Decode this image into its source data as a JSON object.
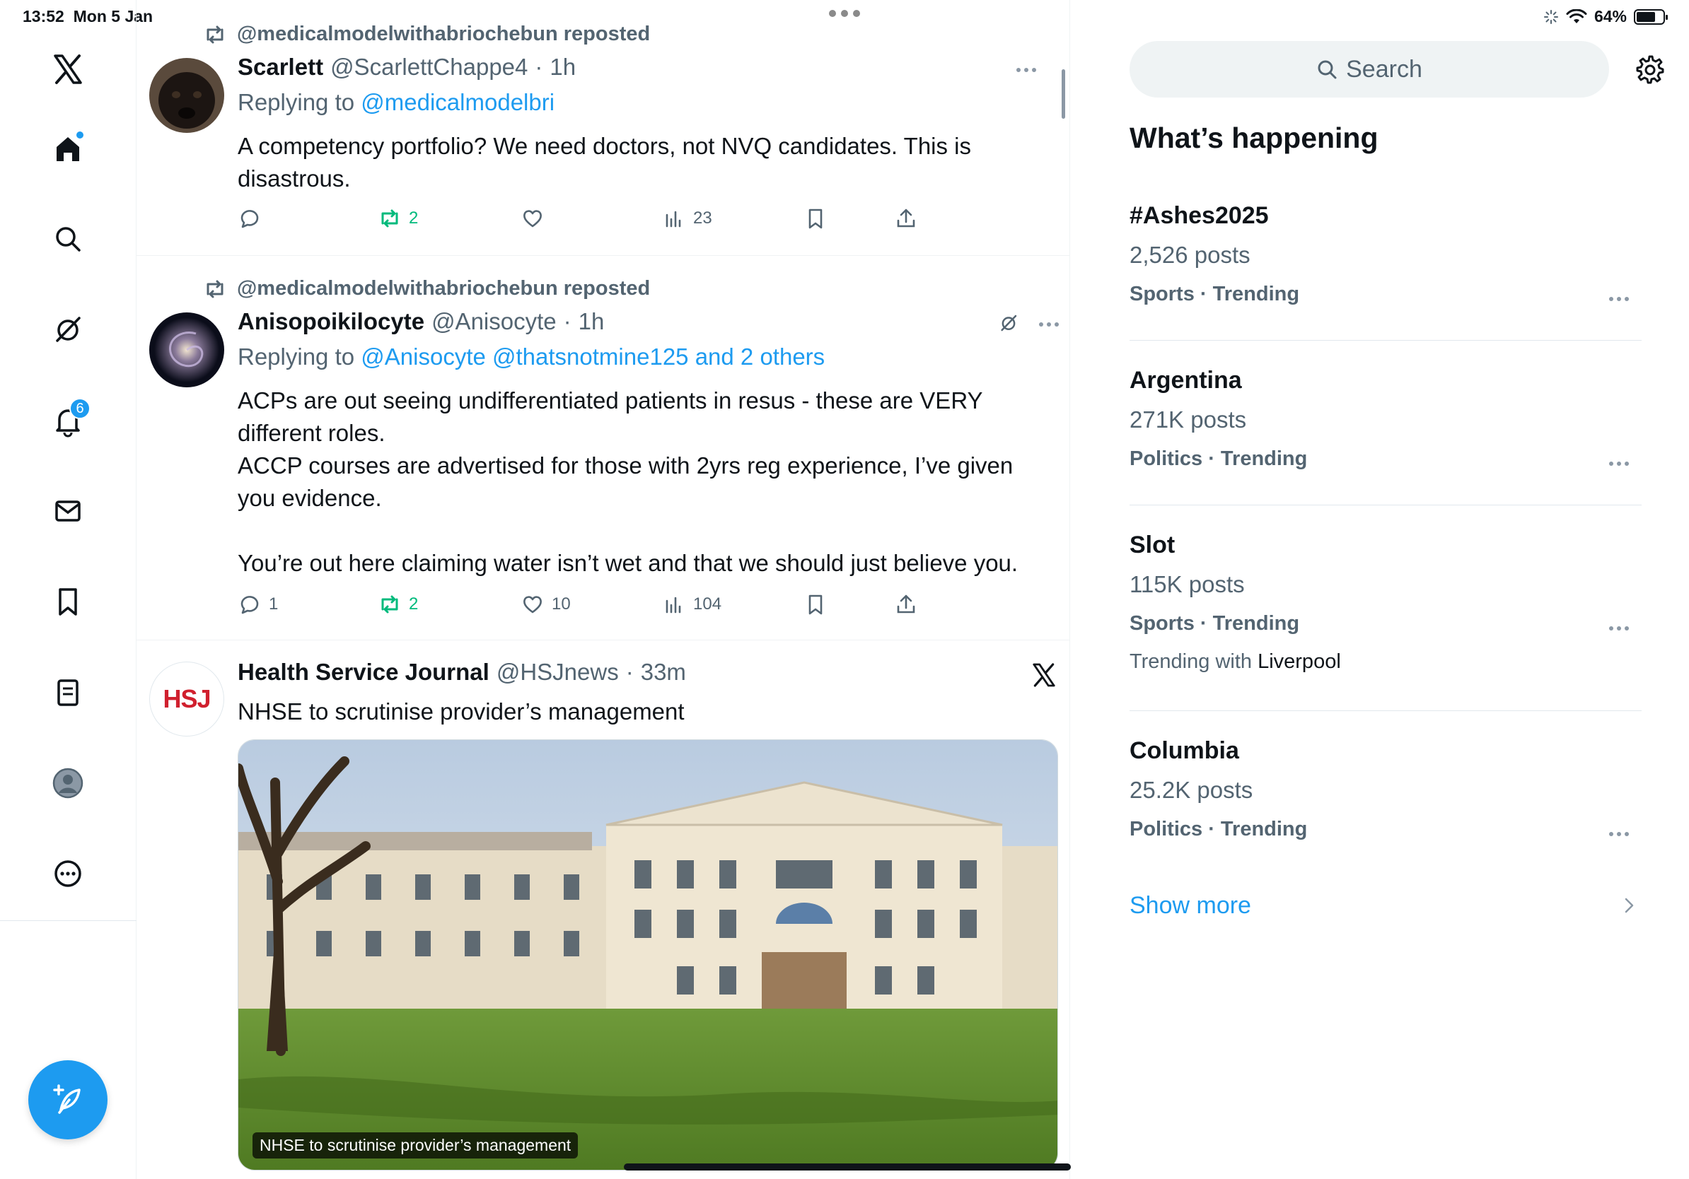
{
  "status_bar": {
    "time": "13:52",
    "date": "Mon 5 Jan",
    "battery": "64%"
  },
  "sidebar": {
    "notifications_badge": "6"
  },
  "feed": {
    "posts": [
      {
        "repost_label": "@medicalmodelwithabriochebun reposted",
        "name": "Scarlett",
        "handle": "@ScarlettChappe4",
        "sep": "·",
        "time": "1h",
        "reply_prefix": "Replying to",
        "reply_to": "@medicalmodelbri",
        "text": "A competency portfolio? We need doctors, not NVQ candidates. This is disastrous.",
        "reposts": "2",
        "views": "23"
      },
      {
        "repost_label": "@medicalmodelwithabriochebun reposted",
        "name": "Anisopoikilocyte",
        "handle": "@Anisocyte",
        "sep": "·",
        "time": "1h",
        "reply_prefix": "Replying to",
        "reply_to": "@Anisocyte @thatsnotmine125 and 2 others",
        "text": "ACPs are out seeing undifferentiated patients in resus - these are VERY different roles.\nACCP courses are advertised for those with 2yrs reg experience, I’ve given you evidence.\n\nYou’re out here claiming water isn’t wet and that we should just believe you.",
        "replies": "1",
        "reposts": "2",
        "likes": "10",
        "views": "104"
      },
      {
        "name": "Health Service Journal",
        "handle": "@HSJnews",
        "sep": "·",
        "time": "33m",
        "avatar_text": "HSJ",
        "text": "NHSE to scrutinise provider’s management",
        "card_caption": "NHSE to scrutinise provider’s management"
      }
    ]
  },
  "right": {
    "search_placeholder": "Search",
    "section_title": "What’s happening",
    "trends": [
      {
        "name": "#Ashes2025",
        "count": "2,526 posts",
        "category": "Sports · Trending"
      },
      {
        "name": "Argentina",
        "count": "271K posts",
        "category": "Politics · Trending"
      },
      {
        "name": "Slot",
        "count": "115K posts",
        "category": "Sports · Trending",
        "extra_prefix": "Trending with",
        "extra_link": "Liverpool"
      },
      {
        "name": "Columbia",
        "count": "25.2K posts",
        "category": "Politics · Trending"
      }
    ],
    "show_more": "Show more"
  },
  "colors": {
    "accent": "#1d9bf0",
    "repost_green": "#00ba7c",
    "muted": "#536471",
    "text": "#0f1419"
  },
  "icons": [
    "x-logo-icon",
    "home-icon",
    "search-icon",
    "grok-icon",
    "bell-icon",
    "mail-icon",
    "bookmark-icon",
    "lists-icon",
    "profile-icon",
    "more-circle-icon",
    "compose-icon",
    "settings-icon"
  ]
}
